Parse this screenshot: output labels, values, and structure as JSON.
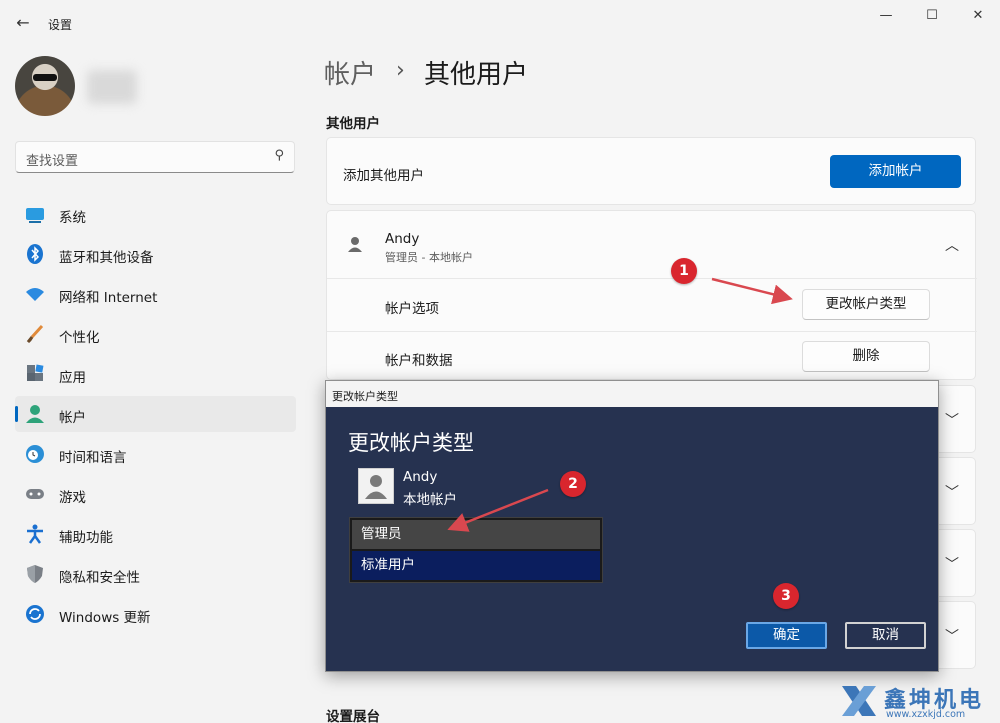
{
  "window": {
    "title": "设置",
    "back_icon": "back-arrow-icon",
    "controls": [
      "minimize-icon",
      "maximize-icon",
      "close-icon"
    ]
  },
  "search": {
    "placeholder": "查找设置",
    "icon": "search-icon"
  },
  "sidebar": {
    "items": [
      {
        "label": "系统",
        "icon": "system-icon",
        "color": "#1e90d6"
      },
      {
        "label": "蓝牙和其他设备",
        "icon": "bluetooth-icon",
        "color": "#1a74d0"
      },
      {
        "label": "网络和 Internet",
        "icon": "wifi-icon",
        "color": "#2a8ae0"
      },
      {
        "label": "个性化",
        "icon": "brush-icon",
        "color": "#e08a3a"
      },
      {
        "label": "应用",
        "icon": "apps-icon",
        "color": "#5a6570"
      },
      {
        "label": "帐户",
        "icon": "account-icon",
        "color": "#2ea37a",
        "active": true
      },
      {
        "label": "时间和语言",
        "icon": "clock-globe-icon",
        "color": "#2b8fd6"
      },
      {
        "label": "游戏",
        "icon": "gamepad-icon",
        "color": "#7a7f86"
      },
      {
        "label": "辅助功能",
        "icon": "accessibility-icon",
        "color": "#1a6fd0"
      },
      {
        "label": "隐私和安全性",
        "icon": "shield-icon",
        "color": "#7a7f86"
      },
      {
        "label": "Windows 更新",
        "icon": "update-icon",
        "color": "#1a74d0"
      }
    ]
  },
  "breadcrumb": {
    "parent": "帐户",
    "separator": "›",
    "current": "其他用户"
  },
  "main": {
    "section_title": "其他用户",
    "add_user": {
      "label": "添加其他用户",
      "button": "添加帐户"
    },
    "user": {
      "name": "Andy",
      "role": "管理员 - 本地帐户",
      "account_options_label": "帐户选项",
      "change_type_button": "更改帐户类型",
      "account_data_label": "帐户和数据",
      "delete_button": "删除"
    },
    "bottom_section_title": "设置展台"
  },
  "dialog": {
    "titlebar": "更改帐户类型",
    "heading": "更改帐户类型",
    "user_name": "Andy",
    "user_account": "本地帐户",
    "options": [
      "管理员",
      "标准用户"
    ],
    "selected": "标准用户",
    "ok": "确定",
    "cancel": "取消"
  },
  "annotations": [
    "1",
    "2",
    "3"
  ],
  "watermark": {
    "text": "鑫坤机电",
    "url": "www.xzxkjd.com"
  },
  "colors": {
    "accent": "#0067c0",
    "badge": "#d9262e",
    "dialog_bg": "#263250",
    "arrow": "#d9484f"
  }
}
